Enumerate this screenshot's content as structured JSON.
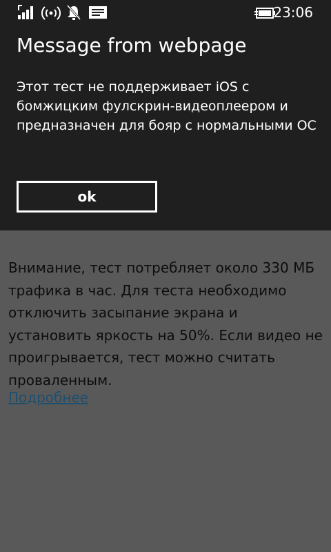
{
  "status_bar": {
    "time": "23:06",
    "icons": [
      "signal-strength-icon",
      "wifi-icon",
      "quiet-hours-bell-icon",
      "message-notification-icon",
      "battery-charging-icon"
    ]
  },
  "dialog": {
    "title": "Message from webpage",
    "message": "Этот тест не поддерживает iOS с бомжицким фулскрин-видеоплеером и предназначен для бояр с нормальными ОС",
    "ok_label": "ok"
  },
  "page": {
    "body_text": "Внимание, тест потребляет около 330 МБ трафика в час. Для теста необходимо отключить засыпание экрана и установить яркость на 50%. Если видео не проигрывается, тест можно считать проваленным.",
    "link_text": "Подробнее"
  },
  "colors": {
    "dialog_background": "#1f1f1f",
    "page_overlay": "#595959",
    "link": "#1e4f6e"
  }
}
